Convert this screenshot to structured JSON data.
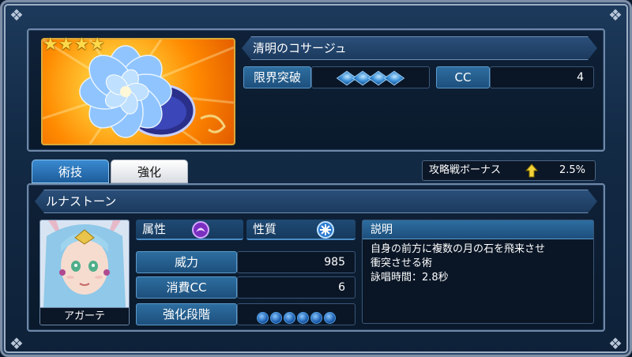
{
  "item": {
    "name": "清明のコサージュ",
    "stars": [
      "★",
      "★",
      "★",
      "★"
    ],
    "limit_break_label": "限界突破",
    "limit_break_level": 4,
    "cc_label": "CC",
    "cc_value": "4"
  },
  "tabs": [
    {
      "label": "術技",
      "active": true
    },
    {
      "label": "強化",
      "active": false
    }
  ],
  "bonus": {
    "label": "攻略戦ボーナス",
    "value": "2.5%",
    "arrow": "up-arrow-icon"
  },
  "skill": {
    "name": "ルナストーン",
    "character_name": "アガーテ",
    "attribute_label": "属性",
    "attribute_icon": "dark-attribute-icon",
    "nature_label": "性質",
    "nature_icon": "burst-nature-icon",
    "power_label": "威力",
    "power_value": "985",
    "cost_label": "消費CC",
    "cost_value": "6",
    "upgrade_label": "強化段階",
    "upgrade_slots": 6,
    "desc_label": "説明",
    "desc_line1": "自身の前方に複数の月の石を飛来させ",
    "desc_line2": "衝突させる術",
    "desc_line3": "詠唱時間：2.8秒"
  },
  "colors": {
    "accent": "#2d6ea0",
    "background": "#132a45",
    "star": "#ffd94a",
    "bonus_arrow": "#f2d43a"
  }
}
